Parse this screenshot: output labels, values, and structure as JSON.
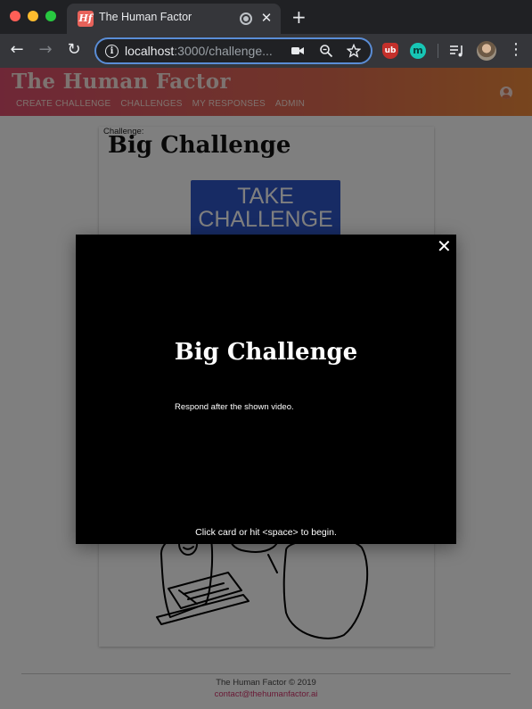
{
  "browser": {
    "tab_title": "The Human Factor",
    "tab_favicon_text": "Hf",
    "url_host": "localhost",
    "url_rest": ":3000/challenge..."
  },
  "site": {
    "title": "The Human Factor",
    "nav": [
      "CREATE CHALLENGE",
      "CHALLENGES",
      "MY RESPONSES",
      "ADMIN"
    ]
  },
  "card": {
    "label": "Challenge:",
    "title": "Big Challenge",
    "button_line1": "TAKE",
    "button_line2": "CHALLENGE"
  },
  "modal": {
    "title": "Big Challenge",
    "description": "Respond after the shown video.",
    "hint": "Click card or hit <space> to begin.",
    "close_glyph": "✕"
  },
  "footer": {
    "copyright": "The Human Factor © 2019",
    "contact": "contact@thehumanfactor.ai"
  },
  "colors": {
    "header_gradient_start": "#de4f6e",
    "header_gradient_end": "#ef8a3c",
    "button_blue": "#2f56c9",
    "link_pink": "#d2336b"
  }
}
